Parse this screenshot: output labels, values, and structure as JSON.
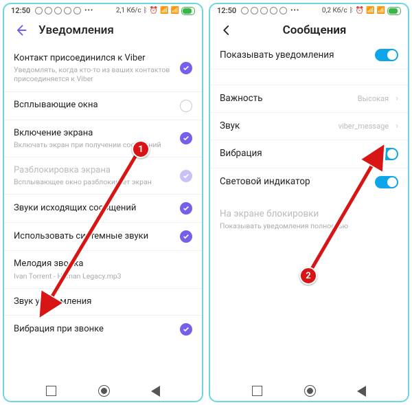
{
  "left": {
    "statusbar": {
      "time": "12:50",
      "net": "2,1 Кб/с"
    },
    "header": {
      "title": "Уведомления"
    },
    "rows": [
      {
        "title": "Контакт присоединился к Viber",
        "sub": "Уведомлять, когда кто-то из ваших контактов присоединяется к Viber",
        "control": "checked"
      },
      {
        "title": "Всплывающие окна",
        "control": "empty"
      },
      {
        "title": "Включение экрана",
        "sub": "Включать экран при получении сообщений",
        "control": "checked"
      },
      {
        "title": "Разблокировка экрана",
        "sub": "Всплывающее окно разблокирует экран",
        "control": "checked-light",
        "disabled": true
      },
      {
        "title": "Звуки исходящих сообщений",
        "control": "checked"
      },
      {
        "title": "Использовать системные звуки",
        "control": "checked"
      },
      {
        "title": "Мелодия звонка",
        "sub": "Ivan Torrent - Human Legacy.mp3"
      },
      {
        "title": "Звук уведомления"
      },
      {
        "title": "Вибрация при звонке",
        "control": "checked"
      }
    ],
    "badge": "1"
  },
  "right": {
    "statusbar": {
      "time": "12:50",
      "net": "0,2 Кб/с"
    },
    "header": {
      "title": "Сообщения"
    },
    "rows": [
      {
        "title": "Показывать уведомления",
        "control": "toggle"
      },
      {
        "title": "Важность",
        "value": "Высокая",
        "chev": true
      },
      {
        "title": "Звук",
        "value": "viber_message",
        "chev": true
      },
      {
        "title": "Вибрация",
        "control": "toggle"
      },
      {
        "title": "Световой индикатор",
        "control": "toggle"
      },
      {
        "title": "На экране блокировки",
        "sub": "Показывать уведомления полностью",
        "disabled": true
      }
    ],
    "badge": "2"
  }
}
